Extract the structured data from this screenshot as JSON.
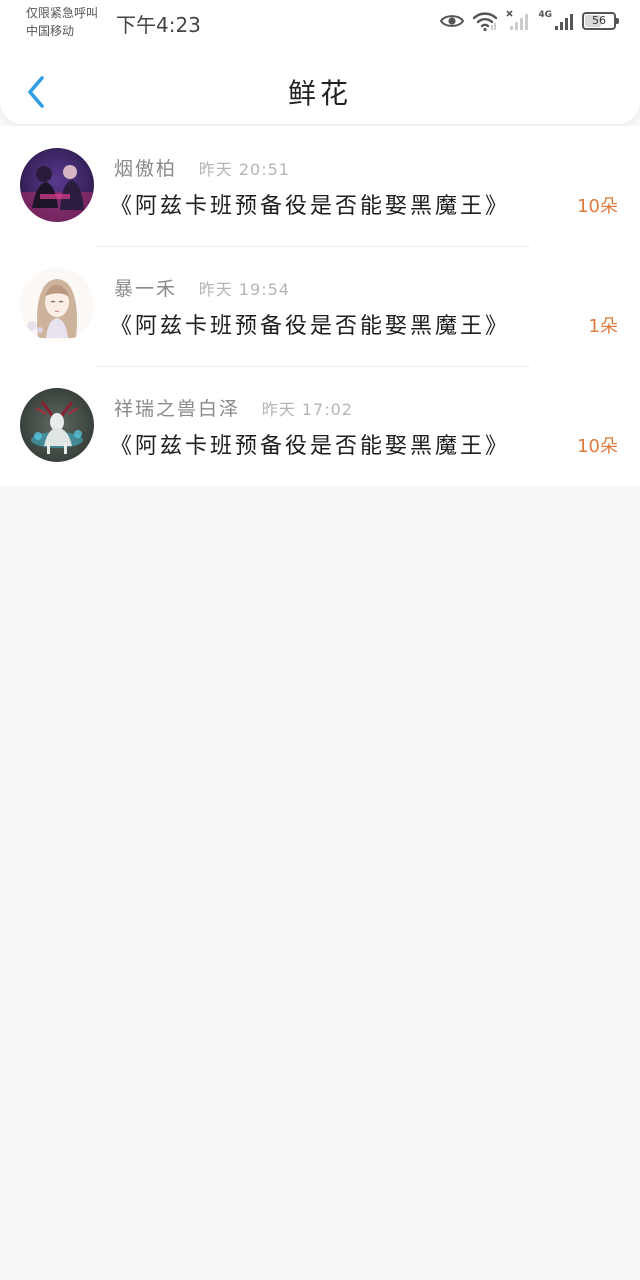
{
  "status_bar": {
    "emergency_text": "仅限紧急呼叫",
    "carrier": "中国移动",
    "time": "下午4:23",
    "network_label": "4G",
    "battery_level": "56",
    "icons": [
      "eye-icon",
      "wifi-icon",
      "signal-bars-icon",
      "signal-bars-icon",
      "battery-icon"
    ]
  },
  "nav": {
    "title": "鲜花",
    "back_icon": "chevron-left-icon",
    "accent_color": "#2f9ee8"
  },
  "flower_records": [
    {
      "name": "烟傲柏",
      "time": "昨天 20:51",
      "work_title": "《阿兹卡班预备役是否能娶黑魔王》",
      "count": "10朵"
    },
    {
      "name": "暴一禾",
      "time": "昨天 19:54",
      "work_title": "《阿兹卡班预备役是否能娶黑魔王》",
      "count": "1朵"
    },
    {
      "name": "祥瑞之兽白泽",
      "time": "昨天 17:02",
      "work_title": "《阿兹卡班预备役是否能娶黑魔王》",
      "count": "10朵"
    }
  ],
  "colors": {
    "count_accent": "#e07a3c",
    "page_background": "#f9f7f8"
  }
}
